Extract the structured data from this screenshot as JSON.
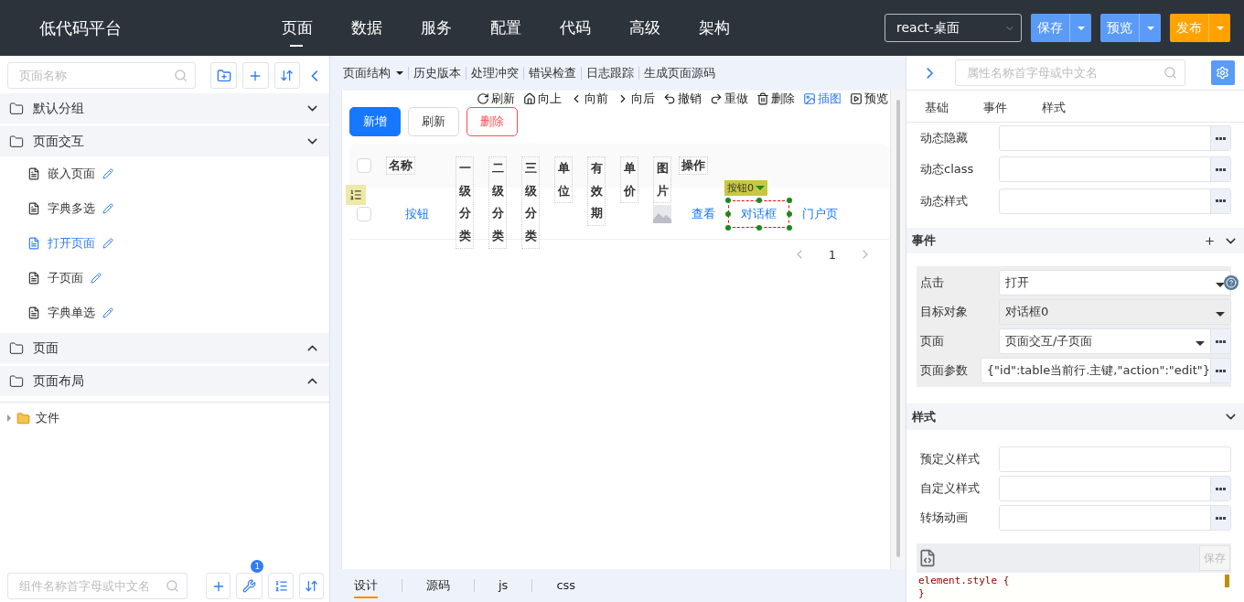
{
  "header": {
    "logo": "低代码平台",
    "nav": [
      {
        "label": "页面",
        "selected": true
      },
      {
        "label": "数据",
        "selected": false
      },
      {
        "label": "服务",
        "selected": false
      },
      {
        "label": "配置",
        "selected": false
      },
      {
        "label": "代码",
        "selected": false
      },
      {
        "label": "高级",
        "selected": false
      },
      {
        "label": "架构",
        "selected": false
      }
    ],
    "framework": "react-桌面",
    "actions": [
      {
        "label": "保存",
        "kind": "primary"
      },
      {
        "label": "预览",
        "kind": "primary"
      },
      {
        "label": "发布",
        "kind": "warning"
      }
    ]
  },
  "left": {
    "search": {
      "placeholder": "页面名称"
    },
    "groups": [
      {
        "label": "默认分组",
        "expanded": true
      },
      {
        "label": "页面交互",
        "expanded": true,
        "children": [
          {
            "label": "嵌入页面",
            "selected": false
          },
          {
            "label": "字典多选",
            "selected": false
          },
          {
            "label": "打开页面",
            "selected": true
          },
          {
            "label": "子页面",
            "selected": false
          },
          {
            "label": "字典单选",
            "selected": false
          }
        ]
      },
      {
        "label": "页面",
        "expanded": false
      },
      {
        "label": "页面布局",
        "expanded": false
      }
    ],
    "file_tree": [
      {
        "label": "文件",
        "expanded": false
      }
    ],
    "component_search": {
      "placeholder": "组件名称首字母或中文名"
    },
    "tool_badge": "1"
  },
  "center": {
    "menu": [
      {
        "label": "页面结构",
        "dropdown": true
      },
      {
        "label": "历史版本",
        "dropdown": false
      },
      {
        "label": "处理冲突",
        "dropdown": false
      },
      {
        "label": "错误检查",
        "dropdown": false
      },
      {
        "label": "日志跟踪",
        "dropdown": false
      },
      {
        "label": "生成页面源码",
        "dropdown": false
      }
    ],
    "actions": [
      {
        "label": "刷新",
        "kind": "refresh",
        "selected": false
      },
      {
        "label": "向上",
        "kind": "home",
        "selected": false
      },
      {
        "label": "向前",
        "kind": "back",
        "selected": false
      },
      {
        "label": "向后",
        "kind": "forward",
        "selected": false
      },
      {
        "label": "撤销",
        "kind": "undo",
        "selected": false
      },
      {
        "label": "重做",
        "kind": "redo",
        "selected": false
      },
      {
        "label": "删除",
        "kind": "trash",
        "selected": false
      },
      {
        "label": "插图",
        "kind": "image",
        "selected": true
      },
      {
        "label": "预览",
        "kind": "play",
        "selected": false
      }
    ],
    "buttons": [
      {
        "label": "新增",
        "kind": "primary"
      },
      {
        "label": "刷新",
        "kind": "default"
      },
      {
        "label": "删除",
        "kind": "danger"
      }
    ],
    "table": {
      "header_checked": false,
      "columns": [
        {
          "label": "名称",
          "vertical": false
        },
        {
          "label": "一级分类",
          "vertical": true
        },
        {
          "label": "二级分类",
          "vertical": true
        },
        {
          "label": "三级分类",
          "vertical": true
        },
        {
          "label": "单位",
          "vertical": true
        },
        {
          "label": "有效期",
          "vertical": true
        },
        {
          "label": "单价",
          "vertical": true
        },
        {
          "label": "图片",
          "vertical": true
        },
        {
          "label": "操作",
          "vertical": false
        }
      ],
      "rows": [
        {
          "checked": false,
          "name": "按钮",
          "has_image": true,
          "operations": [
            {
              "label": "查看",
              "selected": false
            },
            {
              "label": "对话框",
              "selected": true,
              "tag": "按钮0"
            },
            {
              "label": "门户页",
              "selected": false
            }
          ]
        }
      ]
    },
    "pagination": {
      "page": "1"
    },
    "tabs": [
      {
        "label": "设计",
        "selected": true
      },
      {
        "label": "源码",
        "selected": false
      },
      {
        "label": "js",
        "selected": false
      },
      {
        "label": "css",
        "selected": false
      }
    ]
  },
  "right": {
    "search": {
      "placeholder": "属性名称首字母或中文名"
    },
    "tabs": [
      {
        "label": "基础"
      },
      {
        "label": "事件"
      },
      {
        "label": "样式"
      }
    ],
    "props": [
      {
        "label": "动态隐藏",
        "more": true
      },
      {
        "label": "动态class",
        "more": true
      },
      {
        "label": "动态样式",
        "more": true
      }
    ],
    "sections": [
      {
        "title": "事件",
        "expanded": true,
        "addable": true,
        "boxed": true,
        "rows": [
          {
            "label": "点击",
            "value": "打开",
            "kind": "select",
            "more": false,
            "disabled": false,
            "help": true
          },
          {
            "label": "目标对象",
            "value": "对话框0",
            "kind": "select",
            "more": false,
            "disabled": true,
            "help": false
          },
          {
            "label": "页面",
            "value": "页面交互/子页面",
            "kind": "select",
            "more": true,
            "disabled": false,
            "help": false
          },
          {
            "label": "页面参数",
            "value": "{\"id\":table当前行.主键,\"action\":\"edit\"}",
            "kind": "input",
            "more": true,
            "disabled": false,
            "help": false
          }
        ]
      },
      {
        "title": "样式",
        "expanded": true,
        "addable": false,
        "boxed": false,
        "rows": [
          {
            "label": "预定义样式",
            "kind": "input",
            "more": false,
            "disabled": false,
            "help": false
          },
          {
            "label": "自定义样式",
            "kind": "input",
            "more": true,
            "disabled": false,
            "help": false
          },
          {
            "label": "转场动画",
            "kind": "input",
            "more": true,
            "disabled": false,
            "help": false
          }
        ]
      }
    ],
    "code": {
      "save": "保存",
      "save_disabled": true,
      "lines": [
        "element.style {",
        "}"
      ]
    }
  }
}
